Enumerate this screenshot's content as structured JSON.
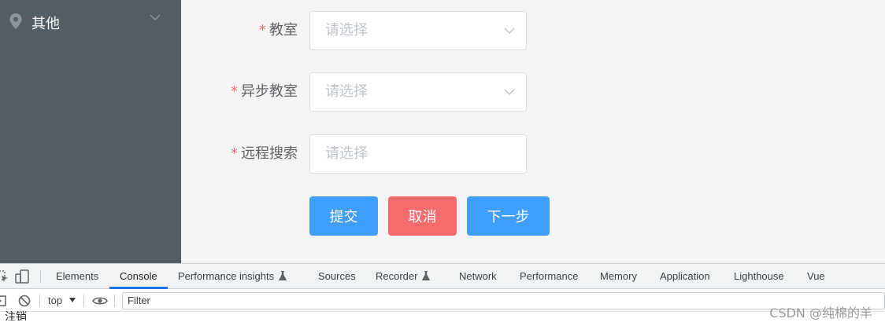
{
  "sidebar": {
    "item": {
      "label": "其他",
      "icon": "location-icon"
    }
  },
  "form": {
    "fields": [
      {
        "label": "教室",
        "required_mark": "*",
        "placeholder": "请选择",
        "has_arrow": true
      },
      {
        "label": "异步教室",
        "required_mark": "*",
        "placeholder": "请选择",
        "has_arrow": true
      },
      {
        "label": "远程搜索",
        "required_mark": "*",
        "placeholder": "请选择",
        "has_arrow": false
      }
    ],
    "buttons": {
      "submit": "提交",
      "cancel": "取消",
      "next": "下一步"
    }
  },
  "devtools": {
    "tabs": [
      "Elements",
      "Console",
      "Performance insights",
      "Sources",
      "Recorder",
      "Network",
      "Performance",
      "Memory",
      "Application",
      "Lighthouse",
      "Vue"
    ],
    "active_tab": "Console",
    "context": "top",
    "filter_placeholder": "Filter",
    "console_output": "注销"
  },
  "watermark": "CSDN @纯棉的羊",
  "colors": {
    "sidebar_bg": "#545c64",
    "primary": "#409eff",
    "danger": "#f56c6c",
    "required": "#f56c6c",
    "placeholder": "#c0c4cc"
  }
}
